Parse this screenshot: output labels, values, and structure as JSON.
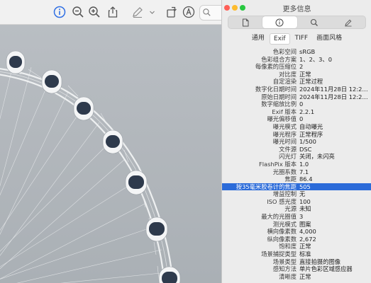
{
  "toolbar": {
    "icons": [
      "info-icon",
      "zoom-out-icon",
      "zoom-in-icon",
      "share-icon",
      "markup-pen-icon",
      "chevron-down-icon",
      "rotate-icon",
      "annotate-icon",
      "search-icon"
    ],
    "active_color": "#2f6fe4"
  },
  "panel": {
    "title": "更多信息",
    "window_controls": {
      "close": "#ff5f57",
      "minimize": "#febc2e",
      "zoom": "#28c840"
    },
    "segments": [
      "document-icon",
      "info-icon",
      "search-icon",
      "pen-icon"
    ],
    "subtabs": [
      "通用",
      "Exif",
      "TIFF",
      "画面风格"
    ],
    "active_subtab": "Exif",
    "highlight_color": "#2b6bd9",
    "rows": [
      {
        "k": "色彩空间",
        "v": "sRGB"
      },
      {
        "k": "色彩组合方案",
        "v": "1、2、3、0"
      },
      {
        "k": "每像素的压缩位",
        "v": "2"
      },
      {
        "k": "对比度",
        "v": "正常"
      },
      {
        "k": "自定渲染",
        "v": "正常过程"
      },
      {
        "k": "数字化日期时间",
        "v": "2024年11月28日 12:2…"
      },
      {
        "k": "原始日期时间",
        "v": "2024年11月28日 12:2…"
      },
      {
        "k": "数字缩放比例",
        "v": "0"
      },
      {
        "k": "Exif 版本",
        "v": "2.2.1"
      },
      {
        "k": "曝光偏移值",
        "v": "0"
      },
      {
        "k": "曝光模式",
        "v": "自动曝光"
      },
      {
        "k": "曝光程序",
        "v": "正常程序"
      },
      {
        "k": "曝光时间",
        "v": "1/500"
      },
      {
        "k": "文件源",
        "v": "DSC"
      },
      {
        "k": "闪光灯",
        "v": "关闭，未闪亮"
      },
      {
        "k": "FlashPix 版本",
        "v": "1.0"
      },
      {
        "k": "光圈系数",
        "v": "7.1"
      },
      {
        "k": "焦距",
        "v": "86.4"
      },
      {
        "k": "按35毫米胶卷计的焦距",
        "v": "505",
        "selected": true
      },
      {
        "k": "增益控制",
        "v": "无"
      },
      {
        "k": "ISO 感光度",
        "v": "100"
      },
      {
        "k": "光源",
        "v": "未知"
      },
      {
        "k": "最大的光圈值",
        "v": "3"
      },
      {
        "k": "测光模式",
        "v": "图案"
      },
      {
        "k": "横向像素数",
        "v": "4,000"
      },
      {
        "k": "纵向像素数",
        "v": "2,672"
      },
      {
        "k": "饱和度",
        "v": "正常"
      },
      {
        "k": "场景捕捉类型",
        "v": "标准"
      },
      {
        "k": "场景类型",
        "v": "直接拍摄的图像"
      },
      {
        "k": "感知方法",
        "v": "单片色彩区域感应器"
      },
      {
        "k": "清晰度",
        "v": "正常"
      }
    ]
  }
}
